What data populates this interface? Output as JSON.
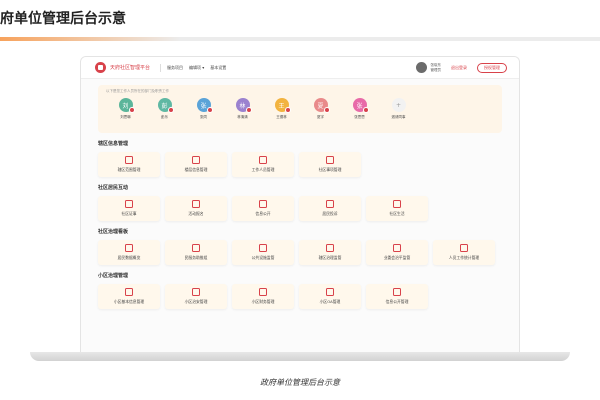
{
  "slide": {
    "title": "府单位管理后台示意",
    "caption": "政府单位管理后台示意"
  },
  "header": {
    "app_title": "天府社区智理平台",
    "nav_links": [
      "服务项目",
      "编辑项 ▾",
      "基本设置"
    ],
    "user_name": "张晓东",
    "user_role": "管理员",
    "logout": "退出登录",
    "button": "授权管理"
  },
  "contacts": {
    "hint": "以下是您工作人员所在的部门及职责工作",
    "items": [
      {
        "initial": "刘",
        "name": "刘思琳",
        "color": "#5bb59a"
      },
      {
        "initial": "彭",
        "name": "彭乐",
        "color": "#5fb8a3"
      },
      {
        "initial": "张",
        "name": "张同",
        "color": "#5aa3d8"
      },
      {
        "initial": "林",
        "name": "林清清",
        "color": "#9b82cf"
      },
      {
        "initial": "王",
        "name": "王德林",
        "color": "#f2b33f"
      },
      {
        "initial": "夏",
        "name": "夏宇",
        "color": "#e98a8a"
      },
      {
        "initial": "张",
        "name": "张思思",
        "color": "#e86aa8"
      },
      {
        "initial": "+",
        "name": "邀请同事",
        "add": true
      }
    ]
  },
  "sections": [
    {
      "title": "辖区信息管理",
      "tiles": [
        "辖区范围管理",
        "楼层信息管理",
        "工作人员管理",
        "社区事项管理"
      ]
    },
    {
      "title": "社区居民互动",
      "tiles": [
        "社区证事",
        "活动报名",
        "信息公开",
        "居民投诉",
        "社区生活"
      ]
    },
    {
      "title": "社区治理看板",
      "tiles": [
        "居民数据概览",
        "民服务助推组",
        "公共设施监管",
        "辖区治理监管",
        "业委会治平监管",
        "人员工作统计管理"
      ]
    },
    {
      "title": "小区治理管理",
      "tiles": [
        "小区基本信息管理",
        "小区治安管理",
        "小区财务管理",
        "小区OA管理",
        "信息公开管理"
      ]
    }
  ],
  "icons": {
    "logo": "logo-icon",
    "tile": "feature-icon",
    "accent": "#d8424a"
  }
}
